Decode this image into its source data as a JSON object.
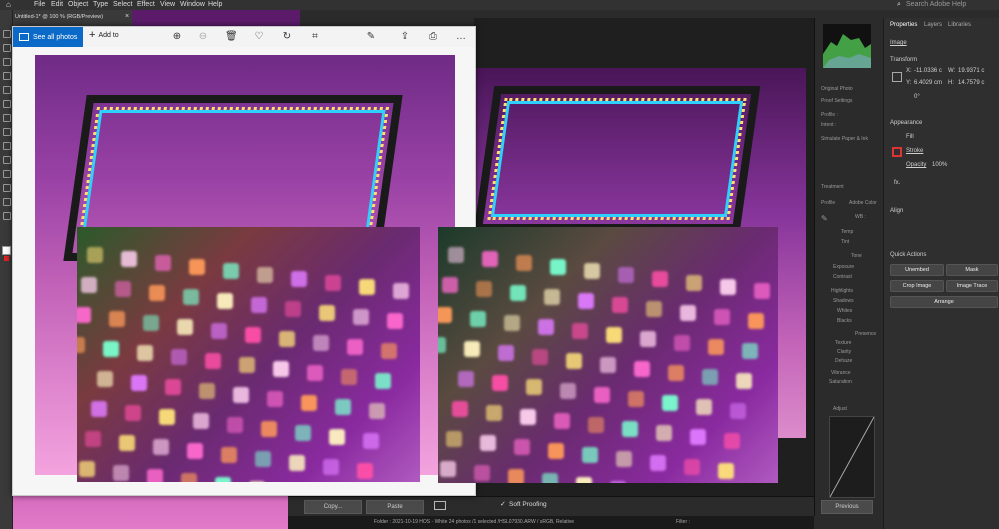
{
  "illustrator": {
    "menu": [
      "File",
      "Edit",
      "Object",
      "Type",
      "Select",
      "Effect",
      "View",
      "Window",
      "Help"
    ],
    "doc_tab": "Untitled-1* @ 100 % (RGB/Preview)",
    "search_placeholder": "Search Adobe Help"
  },
  "photos_app": {
    "see_all": "See all photos",
    "add_to": "Add to"
  },
  "lightroom": {
    "copy": "Copy...",
    "paste": "Paste",
    "soft_proofing": "Soft Proofing",
    "previous": "Previous",
    "status": "Folder : 2021-10-19 HOS - White     24 photos /1 selected /HSL07930.ARW / sRGB, Relative",
    "filter": "Filter :",
    "right_panel": {
      "original_photo": "Original Photo",
      "proof_settings": "Proof Settings",
      "profile": "Profile :",
      "intent": "Intent :",
      "simulate": "Simulate Paper & Ink",
      "treatment": "Treatment",
      "profile_tab": "Profile",
      "adobe_color": "Adobe Color",
      "wb": "WB :",
      "temp": "Temp",
      "tint": "Tint",
      "tone": "Tone",
      "exposure": "Exposure",
      "contrast": "Contrast",
      "highlights": "Highlights",
      "shadows": "Shadows",
      "whites": "Whites",
      "blacks": "Blacks",
      "presence": "Presence",
      "texture": "Texture",
      "clarity": "Clarity",
      "dehaze": "Dehaze",
      "vibrance": "Vibrance",
      "saturation": "Saturation",
      "adjust": "Adjust"
    }
  },
  "properties": {
    "tabs": [
      "Properties",
      "Layers",
      "Libraries"
    ],
    "image_label": "Image",
    "transform": "Transform",
    "x_label": "X:",
    "x_value": "-11.0336 c",
    "w_label": "W:",
    "w_value": "19.9371 c",
    "y_label": "Y:",
    "y_value": "6.4029 cm",
    "h_label": "H:",
    "h_value": "14.7579 c",
    "angle": "0°",
    "appearance": "Appearance",
    "fill": "Fill",
    "stroke": "Stroke",
    "opacity": "Opacity",
    "opacity_value": "100%",
    "fx": "fx.",
    "align": "Align",
    "quick_actions": "Quick Actions",
    "unembed": "Unembed",
    "mask": "Mask",
    "crop_image": "Crop Image",
    "image_trace": "Image Trace",
    "arrange": "Arrange"
  }
}
